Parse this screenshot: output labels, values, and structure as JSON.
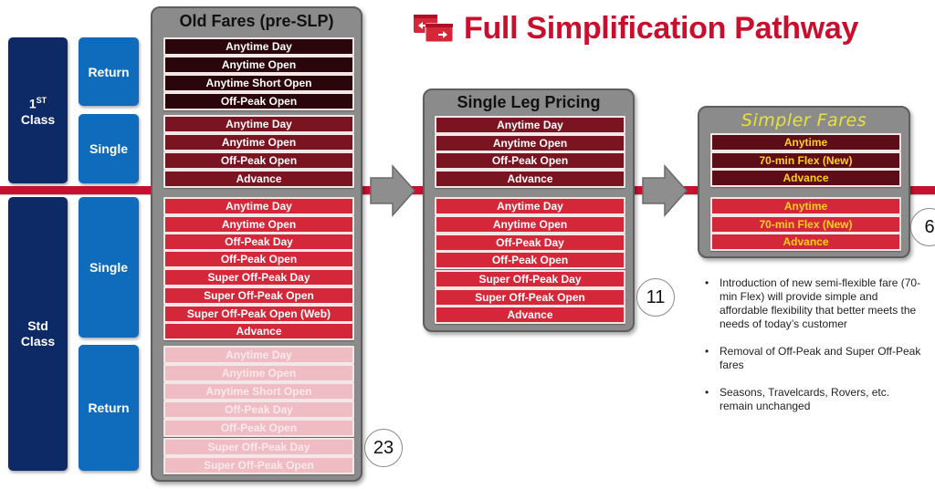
{
  "title": "Full Simplification Pathway",
  "title_icon": "tickets-exchange-icon",
  "colors": {
    "brand_red": "#c8102e",
    "first_class_dark": "#2a050a",
    "first_class_maroon": "#7a1420",
    "std_red": "#d4283a",
    "std_pink": "#f0bcc3",
    "class_navy": "#0e2a66",
    "type_blue": "#0f6bbb",
    "panel_grey": "#8b8b8b",
    "new_fare_text": "#ffd21a"
  },
  "classes": [
    {
      "label_main": "1",
      "label_sup": "ST",
      "label_sub": "Class"
    },
    {
      "label_main": "Std",
      "label_sub": "Class"
    }
  ],
  "ticket_types": {
    "first_return": "Return",
    "first_single": "Single",
    "std_single": "Single",
    "std_return": "Return"
  },
  "old_fares": {
    "title": "Old Fares (pre-SLP)",
    "count": "23",
    "first_return": [
      "Anytime Day",
      "Anytime Open",
      "Anytime Short Open",
      "Off-Peak Open"
    ],
    "first_single": [
      "Anytime Day",
      "Anytime Open",
      "Off-Peak Open",
      "Advance"
    ],
    "std_single": [
      "Anytime Day",
      "Anytime Open",
      "Off-Peak Day",
      "Off-Peak Open",
      "Super Off-Peak Day",
      "Super Off-Peak Open",
      "Super Off-Peak Open (Web)",
      "Advance"
    ],
    "std_return": [
      "Anytime Day",
      "Anytime Open",
      "Anytime Short Open",
      "Off-Peak Day",
      "Off-Peak Open",
      "Super Off-Peak Day",
      "Super Off-Peak Open"
    ]
  },
  "single_leg": {
    "title": "Single Leg Pricing",
    "count": "11",
    "first": [
      "Anytime Day",
      "Anytime Open",
      "Off-Peak Open",
      "Advance"
    ],
    "std": [
      "Anytime Day",
      "Anytime Open",
      "Off-Peak Day",
      "Off-Peak Open",
      "Super Off-Peak Day",
      "Super Off-Peak Open",
      "Advance"
    ]
  },
  "simpler_fares": {
    "title": "Simpler Fares",
    "count": "6",
    "first": [
      "Anytime",
      "70-min Flex (New)",
      "Advance"
    ],
    "std": [
      "Anytime",
      "70-min Flex (New)",
      "Advance"
    ]
  },
  "bullets": [
    "Introduction of new semi-flexible fare (70-min Flex) will provide simple and affordable flexibility that better meets the needs of today’s customer",
    "Removal of Off-Peak and Super Off-Peak fares",
    "Seasons, Travelcards, Rovers, etc. remain unchanged"
  ]
}
